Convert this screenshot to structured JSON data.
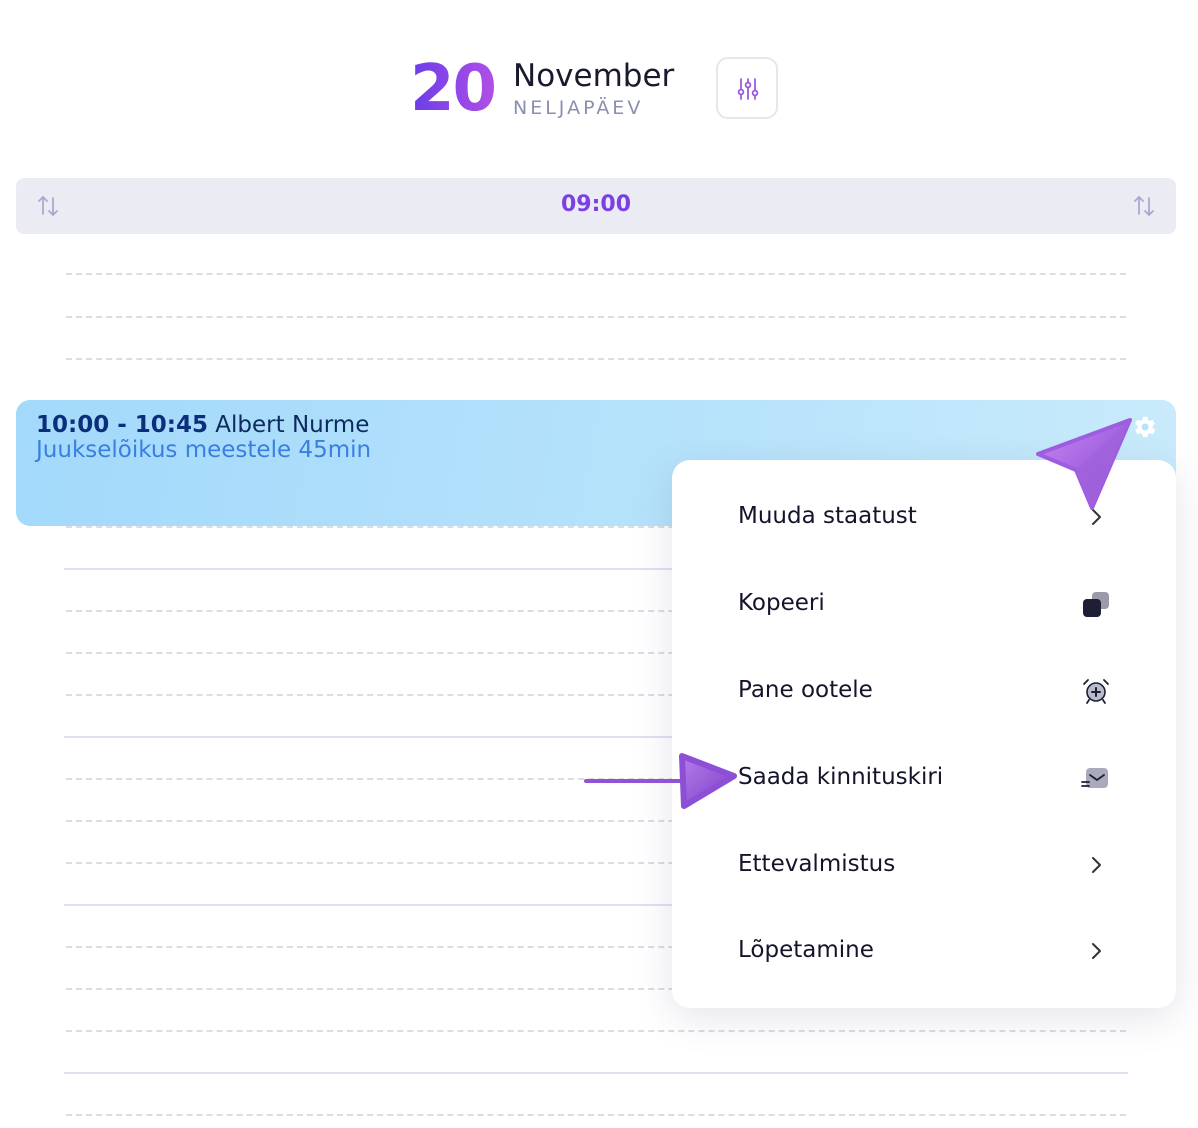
{
  "header": {
    "day_number": "20",
    "month": "November",
    "weekday": "NELJAPÄEV",
    "filter_icon": "sliders-icon"
  },
  "time_bar": {
    "time": "09:00",
    "sort_icon": "sort-arrows-icon"
  },
  "appointment": {
    "time_range": "10:00 - 10:45",
    "client": "Albert Nurme",
    "service": "Juukselõikus meestele 45min",
    "settings_icon": "gear-icon",
    "color": "#a3d9fb"
  },
  "context_menu": {
    "items": [
      {
        "label": "Muuda staatust",
        "icon": "chevron-right-icon"
      },
      {
        "label": "Kopeeri",
        "icon": "copy-icon"
      },
      {
        "label": "Pane ootele",
        "icon": "alarm-add-icon"
      },
      {
        "label": "Saada kinnituskiri",
        "icon": "mail-send-icon"
      },
      {
        "label": "Ettevalmistus",
        "icon": "chevron-right-icon"
      },
      {
        "label": "Lõpetamine",
        "icon": "chevron-right-icon"
      }
    ]
  },
  "colors": {
    "accent": "#7b3fe4",
    "appointment_bg": "#a3d9fb",
    "cursor": "#9b5be0"
  }
}
